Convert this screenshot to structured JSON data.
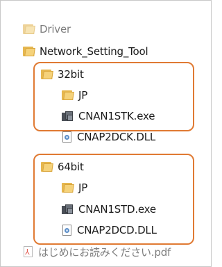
{
  "tree": {
    "items": [
      {
        "label": "Driver",
        "icon": "folder-icon",
        "faded": true
      },
      {
        "label": "Network_Setting_Tool",
        "icon": "folder-icon"
      },
      {
        "label": "32bit",
        "icon": "folder-icon"
      },
      {
        "label": "JP",
        "icon": "folder-icon"
      },
      {
        "label": "CNAN1STK.exe",
        "icon": "exe-icon"
      },
      {
        "label": "CNAP2DCK.DLL",
        "icon": "dll-icon"
      },
      {
        "label": "64bit",
        "icon": "folder-icon"
      },
      {
        "label": "JP",
        "icon": "folder-icon"
      },
      {
        "label": "CNAN1STD.exe",
        "icon": "exe-icon"
      },
      {
        "label": "CNAP2DCD.DLL",
        "icon": "dll-icon"
      },
      {
        "label": "はじめにお読みください.pdf",
        "icon": "pdf-icon",
        "faded": true
      }
    ]
  },
  "colors": {
    "highlight_border": "#e07a33"
  }
}
